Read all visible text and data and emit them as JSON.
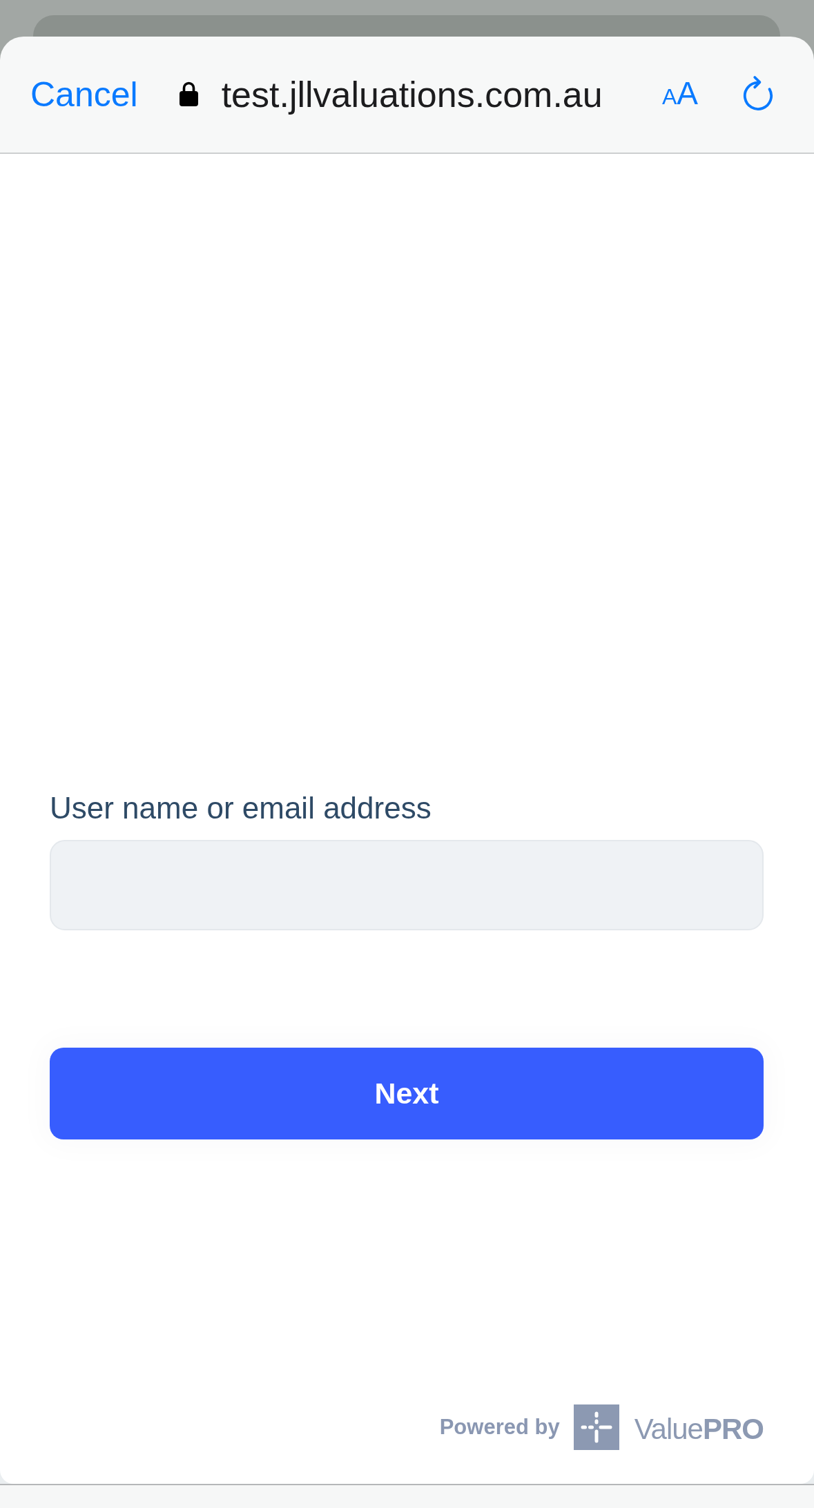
{
  "browser_bar": {
    "cancel": "Cancel",
    "secure": true,
    "url": "test.jllvaluations.com.au",
    "text_size": {
      "small": "A",
      "large": "A"
    }
  },
  "login_form": {
    "field_label": "User name or email address",
    "button": "Next"
  },
  "footer": {
    "powered_by": "Powered by",
    "brand": "Value**PRO**"
  }
}
